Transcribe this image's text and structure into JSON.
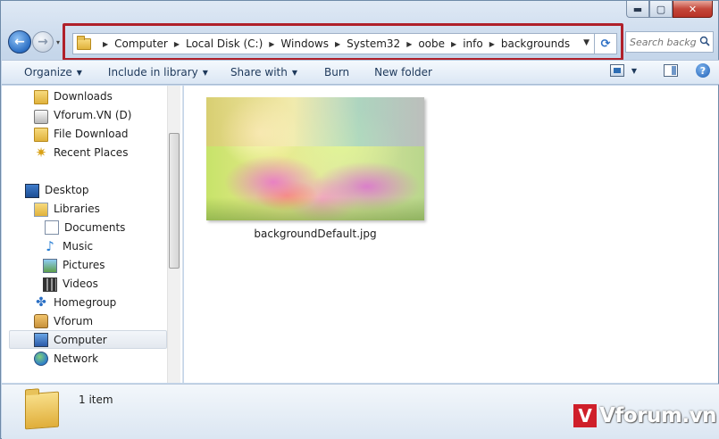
{
  "window": {
    "caption_buttons": {
      "minimize": "▬",
      "maximize": "▢",
      "close": "✕"
    }
  },
  "nav": {
    "back_icon": "arrow-left-icon",
    "forward_icon": "arrow-right-icon",
    "back_glyph": "←",
    "forward_glyph": "→",
    "history_dropdown_glyph": "▾"
  },
  "address_bar": {
    "root_icon": "folder-icon",
    "path": [
      "Computer",
      "Local Disk (C:)",
      "Windows",
      "System32",
      "oobe",
      "info",
      "backgrounds"
    ],
    "separator_glyph": "▶",
    "dropdown_glyph": "▼",
    "refresh_glyph": "⟳",
    "highlight_color": "#b0202a"
  },
  "search": {
    "placeholder": "Search backgrounds",
    "icon": "search-icon"
  },
  "toolbar": {
    "organize": "Organize",
    "include_in_library": "Include in library",
    "share_with": "Share with",
    "burn": "Burn",
    "new_folder": "New folder",
    "dropdown_glyph": "▼",
    "help_glyph": "?"
  },
  "navpane": {
    "items": [
      {
        "label": "Downloads",
        "icon": "folder-icon"
      },
      {
        "label": "Vforum.VN (D)",
        "icon": "drive-icon"
      },
      {
        "label": "File Download",
        "icon": "folder-icon"
      },
      {
        "label": "Recent Places",
        "icon": "recent-places-icon"
      },
      {
        "label": "Desktop",
        "icon": "desktop-icon"
      },
      {
        "label": "Libraries",
        "icon": "libraries-icon"
      },
      {
        "label": "Documents",
        "icon": "documents-icon"
      },
      {
        "label": "Music",
        "icon": "music-icon"
      },
      {
        "label": "Pictures",
        "icon": "pictures-icon"
      },
      {
        "label": "Videos",
        "icon": "videos-icon"
      },
      {
        "label": "Homegroup",
        "icon": "homegroup-icon"
      },
      {
        "label": "Vforum",
        "icon": "user-folder-icon"
      },
      {
        "label": "Computer",
        "icon": "computer-icon"
      },
      {
        "label": "Network",
        "icon": "network-icon"
      }
    ],
    "selected": "Computer"
  },
  "content": {
    "files": [
      {
        "name": "backgroundDefault.jpg",
        "type": "image"
      }
    ]
  },
  "statusbar": {
    "item_count": "1 item",
    "icon": "folder-icon"
  },
  "watermark": {
    "logo_letter": "V",
    "text": "Vforum.vn",
    "accent": "#cf1f2a"
  }
}
